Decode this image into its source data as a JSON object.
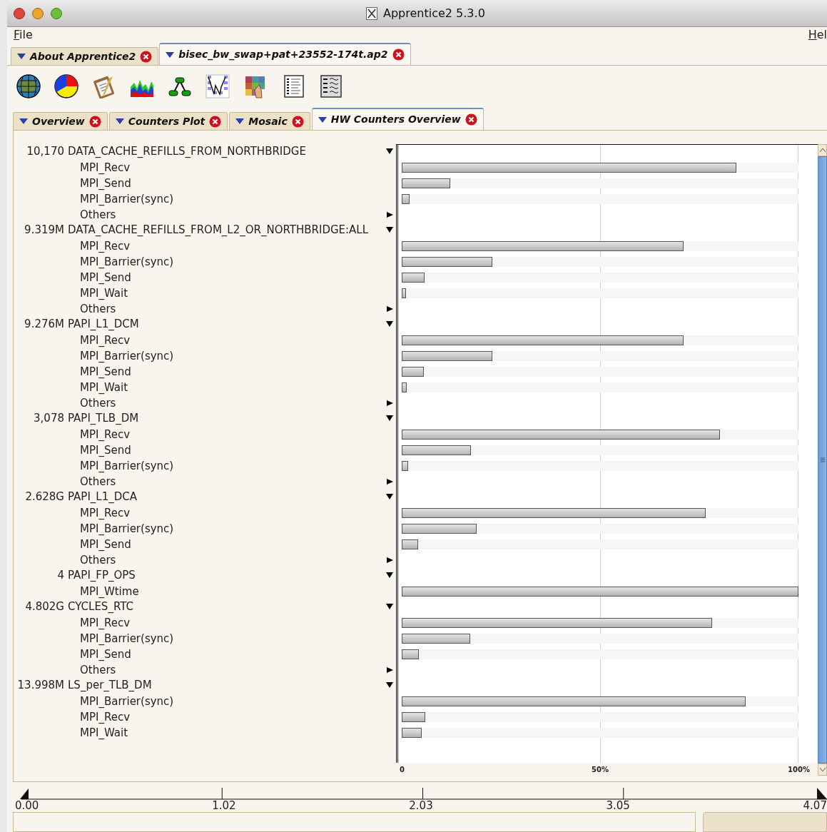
{
  "window": {
    "title": "Apprentice2 5.3.0"
  },
  "menu": [
    {
      "label": "File"
    },
    {
      "label": "Hel"
    }
  ],
  "file_tabs": [
    {
      "label": "About Apprentice2",
      "selected": false
    },
    {
      "label": "bisec_bw_swap+pat+23552-174t.ap2",
      "selected": true
    }
  ],
  "view_tabs": [
    {
      "label": "Overview",
      "selected": false
    },
    {
      "label": "Counters Plot",
      "selected": false
    },
    {
      "label": "Mosaic",
      "selected": false
    },
    {
      "label": "HW Counters Overview",
      "selected": true
    }
  ],
  "counters": [
    {
      "value": "10,170",
      "name": "DATA_CACHE_REFILLS_FROM_NORTHBRIDGE",
      "expanded": true,
      "children": [
        {
          "name": "MPI_Recv",
          "level": 0.843
        },
        {
          "name": "MPI_Send",
          "level": 0.122
        },
        {
          "name": "MPI_Barrier(sync)",
          "level": 0.02
        },
        {
          "name": "Others",
          "expanded": false
        }
      ]
    },
    {
      "value": "9.319M",
      "name": "DATA_CACHE_REFILLS_FROM_L2_OR_NORTHBRIDGE:ALL",
      "expanded": true,
      "children": [
        {
          "name": "MPI_Recv",
          "level": 0.71
        },
        {
          "name": "MPI_Barrier(sync)",
          "level": 0.228
        },
        {
          "name": "MPI_Send",
          "level": 0.058
        },
        {
          "name": "MPI_Wait",
          "level": 0.011
        },
        {
          "name": "Others",
          "expanded": false
        }
      ]
    },
    {
      "value": "9.276M",
      "name": "PAPI_L1_DCM",
      "expanded": true,
      "children": [
        {
          "name": "MPI_Recv",
          "level": 0.71
        },
        {
          "name": "MPI_Barrier(sync)",
          "level": 0.228
        },
        {
          "name": "MPI_Send",
          "level": 0.056
        },
        {
          "name": "MPI_Wait",
          "level": 0.013
        },
        {
          "name": "Others",
          "expanded": false
        }
      ]
    },
    {
      "value": "3,078",
      "name": "PAPI_TLB_DM",
      "expanded": true,
      "children": [
        {
          "name": "MPI_Recv",
          "level": 0.802
        },
        {
          "name": "MPI_Send",
          "level": 0.174
        },
        {
          "name": "MPI_Barrier(sync)",
          "level": 0.016
        },
        {
          "name": "Others",
          "expanded": false
        }
      ]
    },
    {
      "value": "2.628G",
      "name": "PAPI_L1_DCA",
      "expanded": true,
      "children": [
        {
          "name": "MPI_Recv",
          "level": 0.766
        },
        {
          "name": "MPI_Barrier(sync)",
          "level": 0.189
        },
        {
          "name": "MPI_Send",
          "level": 0.041
        },
        {
          "name": "Others",
          "expanded": false
        }
      ]
    },
    {
      "value": "4",
      "name": "PAPI_FP_OPS",
      "expanded": true,
      "children": [
        {
          "name": "MPI_Wtime",
          "level": 1.0
        }
      ]
    },
    {
      "value": "4.802G",
      "name": "CYCLES_RTC",
      "expanded": true,
      "children": [
        {
          "name": "MPI_Recv",
          "level": 0.782
        },
        {
          "name": "MPI_Barrier(sync)",
          "level": 0.173
        },
        {
          "name": "MPI_Send",
          "level": 0.043
        },
        {
          "name": "Others",
          "expanded": false
        }
      ]
    },
    {
      "value": "13.998M",
      "name": "LS_per_TLB_DM",
      "expanded": true,
      "children": [
        {
          "name": "MPI_Barrier(sync)",
          "level": 0.867
        },
        {
          "name": "MPI_Recv",
          "level": 0.059
        },
        {
          "name": "MPI_Wait",
          "level": 0.05
        }
      ]
    }
  ],
  "axis_labels": [
    "0",
    "50%",
    "100%"
  ],
  "timeline": {
    "ticks": [
      "0.00",
      "1.02",
      "2.03",
      "3.05",
      "4.07"
    ]
  }
}
